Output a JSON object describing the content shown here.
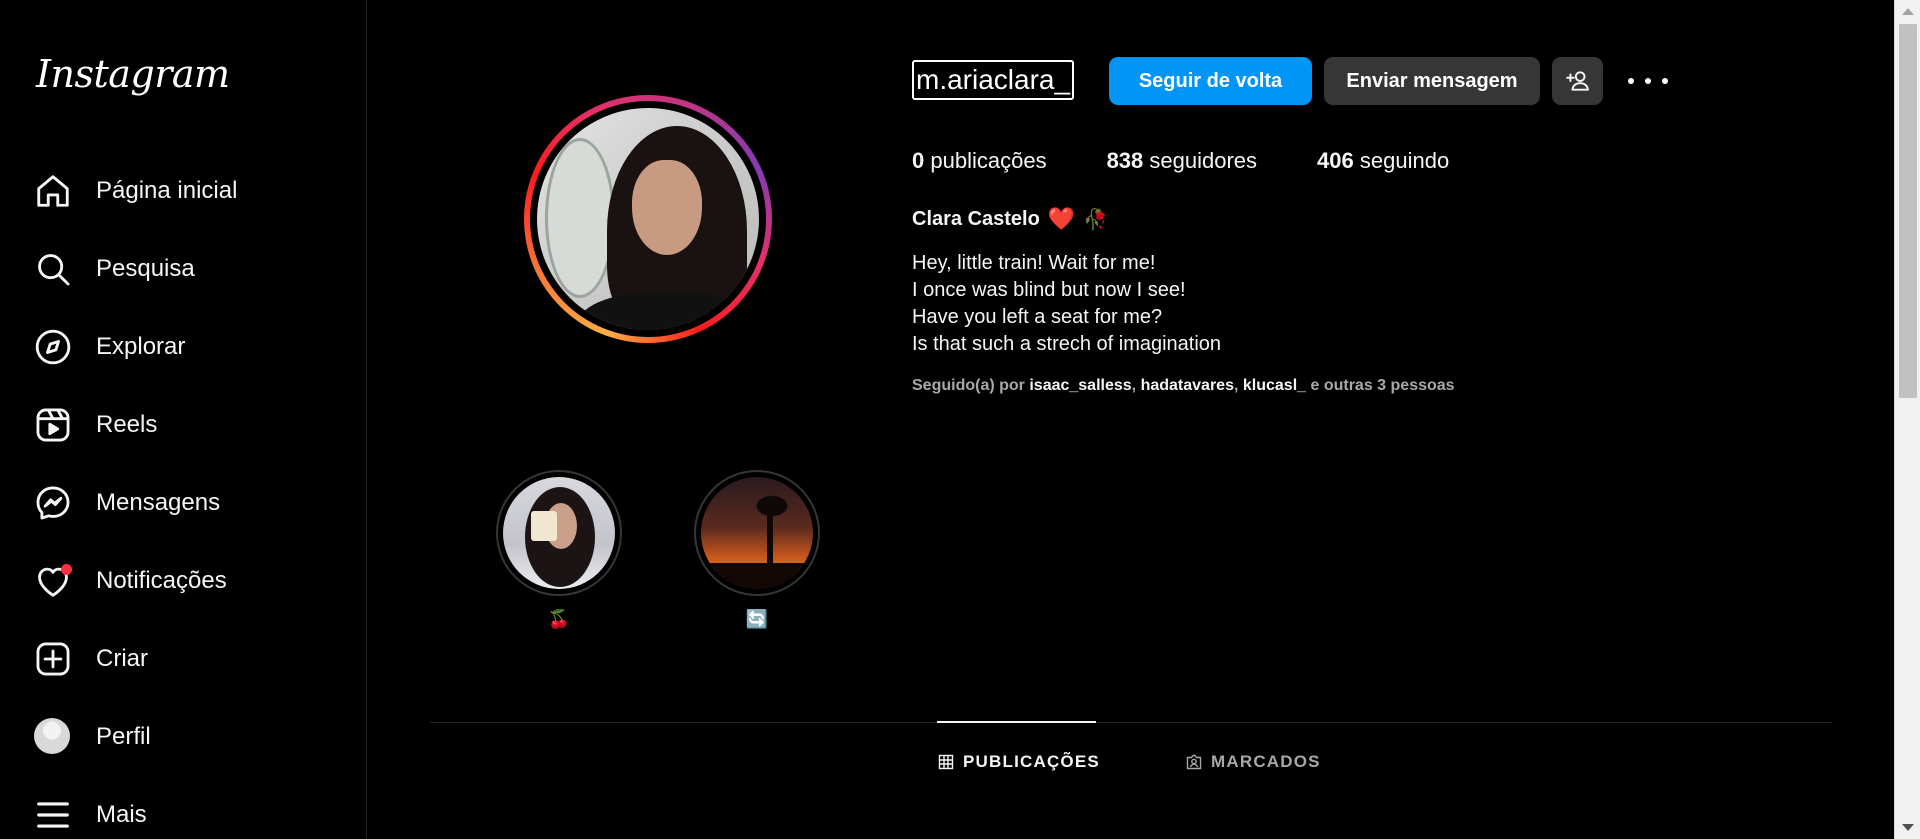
{
  "brand": {
    "logo_text": "Instagram"
  },
  "sidebar": {
    "items": [
      {
        "label": "Página inicial",
        "icon": "home-icon"
      },
      {
        "label": "Pesquisa",
        "icon": "search-icon"
      },
      {
        "label": "Explorar",
        "icon": "compass-icon"
      },
      {
        "label": "Reels",
        "icon": "reels-icon"
      },
      {
        "label": "Mensagens",
        "icon": "messenger-icon"
      },
      {
        "label": "Notificações",
        "icon": "heart-icon"
      },
      {
        "label": "Criar",
        "icon": "plus-square-icon"
      },
      {
        "label": "Perfil",
        "icon": "avatar"
      },
      {
        "label": "Mais",
        "icon": "menu-icon"
      }
    ]
  },
  "profile": {
    "username": "m.ariaclara_",
    "follow_back_label": "Seguir de volta",
    "send_message_label": "Enviar mensagem",
    "stats": {
      "posts_count": "0",
      "posts_label": "publicações",
      "followers_count": "838",
      "followers_label": "seguidores",
      "following_count": "406",
      "following_label": "seguindo"
    },
    "full_name": "Clara Castelo",
    "name_emojis": [
      "❤️",
      "🥀"
    ],
    "bio_lines": [
      "Hey, little train! Wait for me!",
      "I once was blind but now I see!",
      "Have you left a seat for me?",
      "Is that such a strech of imagination"
    ],
    "followed_by": {
      "prefix": "Seguido(a) por",
      "users": [
        "isaac_salless",
        "hadatavares",
        "klucasl_"
      ],
      "suffix": "e outras 3 pessoas"
    }
  },
  "highlights": [
    {
      "label": "🍒"
    },
    {
      "label": "🔄"
    }
  ],
  "tabs": [
    {
      "label": "PUBLICAÇÕES",
      "icon": "grid-icon",
      "active": true
    },
    {
      "label": "MARCADOS",
      "icon": "tagged-icon",
      "active": false
    }
  ],
  "colors": {
    "background": "#000000",
    "primary_button": "#0095f6",
    "secondary_button": "#363636",
    "notification_dot": "#ff3040",
    "muted_text": "#a8a8a8"
  }
}
